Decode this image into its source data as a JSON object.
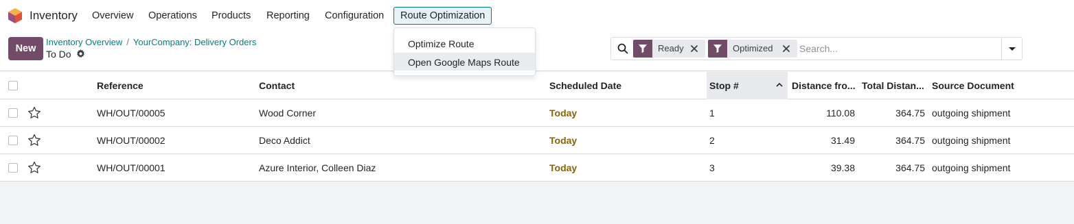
{
  "app": {
    "name": "Inventory"
  },
  "nav": {
    "items": [
      "Overview",
      "Operations",
      "Products",
      "Reporting",
      "Configuration"
    ],
    "active": "Route Optimization"
  },
  "dropdown": {
    "items": [
      "Optimize Route",
      "Open Google Maps Route"
    ]
  },
  "control": {
    "new_label": "New",
    "breadcrumb": [
      "Inventory Overview",
      "YourCompany: Delivery Orders"
    ],
    "breadcrumb_sep": "/",
    "current": "To Do"
  },
  "search": {
    "facets": [
      "Ready",
      "Optimized"
    ],
    "placeholder": "Search..."
  },
  "table": {
    "columns": [
      "Reference",
      "Contact",
      "Scheduled Date",
      "Stop #",
      "Distance fro...",
      "Total Distan...",
      "Source Document"
    ],
    "rows": [
      {
        "reference": "WH/OUT/00005",
        "contact": "Wood Corner",
        "date": "Today",
        "stop": "1",
        "distance": "110.08",
        "total": "364.75",
        "source": "outgoing shipment"
      },
      {
        "reference": "WH/OUT/00002",
        "contact": "Deco Addict",
        "date": "Today",
        "stop": "2",
        "distance": "31.49",
        "total": "364.75",
        "source": "outgoing shipment"
      },
      {
        "reference": "WH/OUT/00001",
        "contact": "Azure Interior, Colleen Diaz",
        "date": "Today",
        "stop": "3",
        "distance": "39.38",
        "total": "364.75",
        "source": "outgoing shipment"
      }
    ]
  },
  "colors": {
    "brand": "#714b67",
    "accent": "#017e84",
    "today": "#8a6200"
  },
  "icons": [
    "app-logo-icon",
    "gear-icon",
    "search-icon",
    "filter-icon",
    "close-icon",
    "chevron-down-icon",
    "chevron-up-icon",
    "star-icon"
  ]
}
